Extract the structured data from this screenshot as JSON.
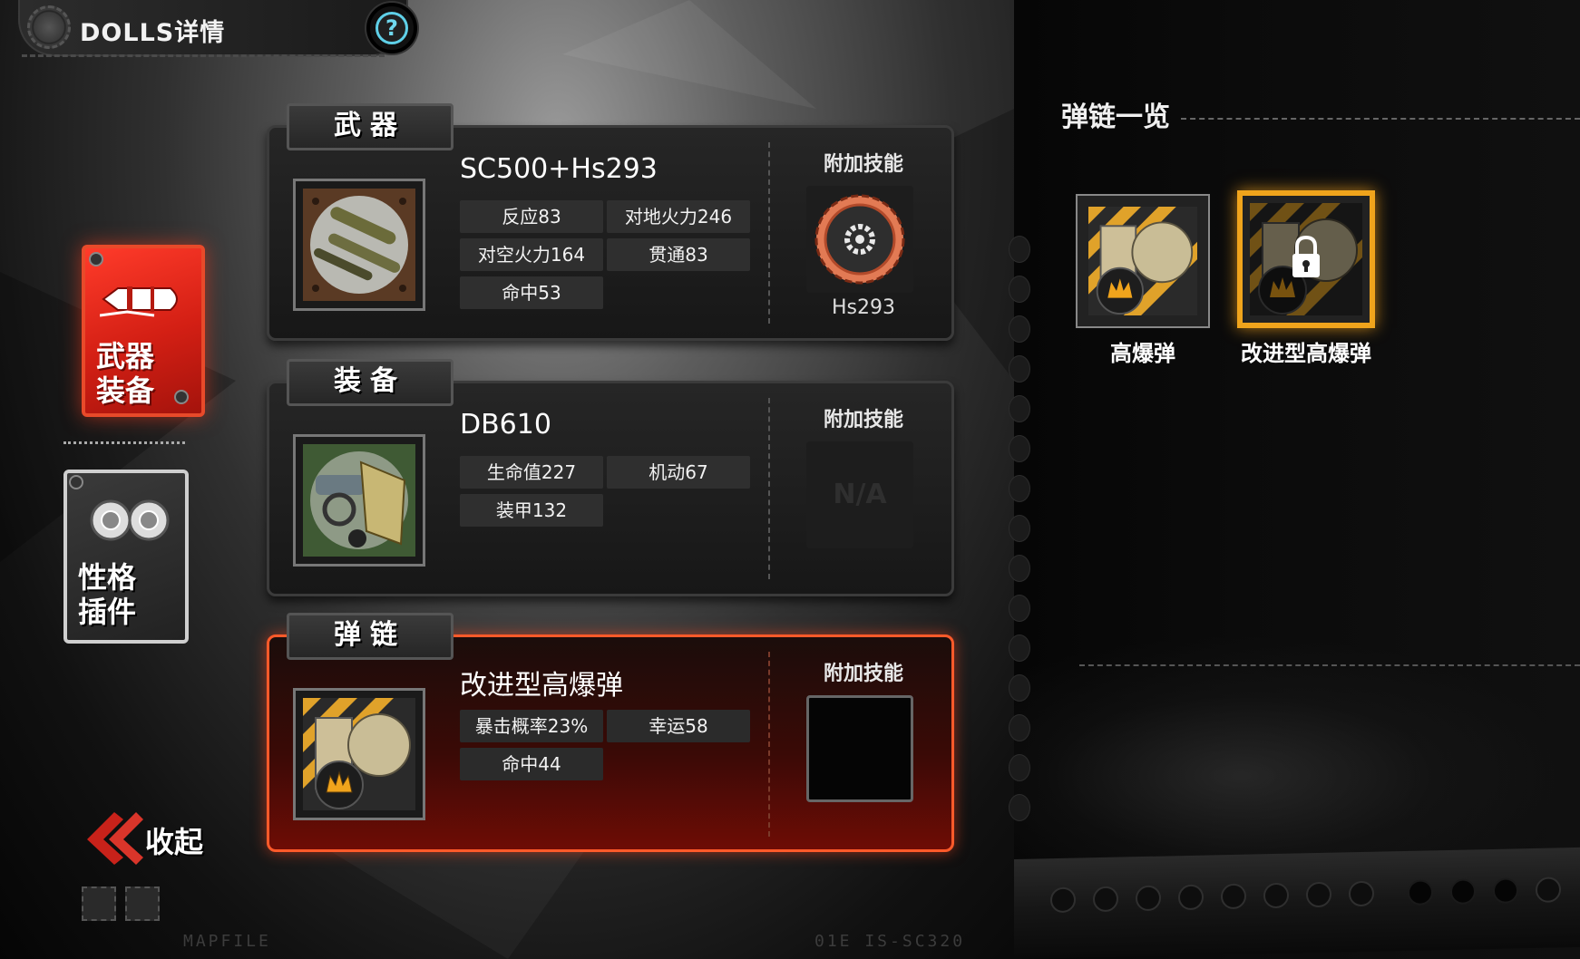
{
  "header": {
    "title": "DOLLS详情",
    "help_symbol": "?"
  },
  "nav": {
    "weapon_equip_label_line1": "武器",
    "weapon_equip_label_line2": "装备",
    "trait_plugin_label_line1": "性格",
    "trait_plugin_label_line2": "插件",
    "collapse_label": "收起"
  },
  "footer": {
    "left_code": "MAPFILE",
    "right_code": "01E  IS-SC320"
  },
  "panels": {
    "weapon": {
      "tab": "武器",
      "name": "SC500+Hs293",
      "stats": [
        "反应83",
        "对地火力246",
        "对空火力164",
        "贯通83",
        "命中53"
      ],
      "skill_label": "附加技能",
      "skill_name": "Hs293"
    },
    "equipment": {
      "tab": "装备",
      "name": "DB610",
      "stats": [
        "生命值227",
        "机动67",
        "装甲132"
      ],
      "skill_label": "附加技能",
      "skill_value": "N/A"
    },
    "ammo": {
      "tab": "弹链",
      "name": "改进型高爆弹",
      "stats": [
        "暴击概率23%",
        "幸运58",
        "命中44"
      ],
      "skill_label": "附加技能"
    }
  },
  "ammo_list": {
    "title": "弹链一览",
    "items": [
      {
        "label": "高爆弹",
        "locked": false,
        "selected": false
      },
      {
        "label": "改进型高爆弹",
        "locked": true,
        "selected": true
      }
    ]
  },
  "colors": {
    "accent_red": "#e2251a",
    "selected_gold": "#f0a41c",
    "help_cyan": "#5fd0e8"
  },
  "icons": [
    "gear-icon",
    "help-icon",
    "bullet-icon",
    "tires-icon",
    "chevron-left-icon",
    "skill-gear-icon",
    "lock-icon",
    "explosion-icon"
  ]
}
